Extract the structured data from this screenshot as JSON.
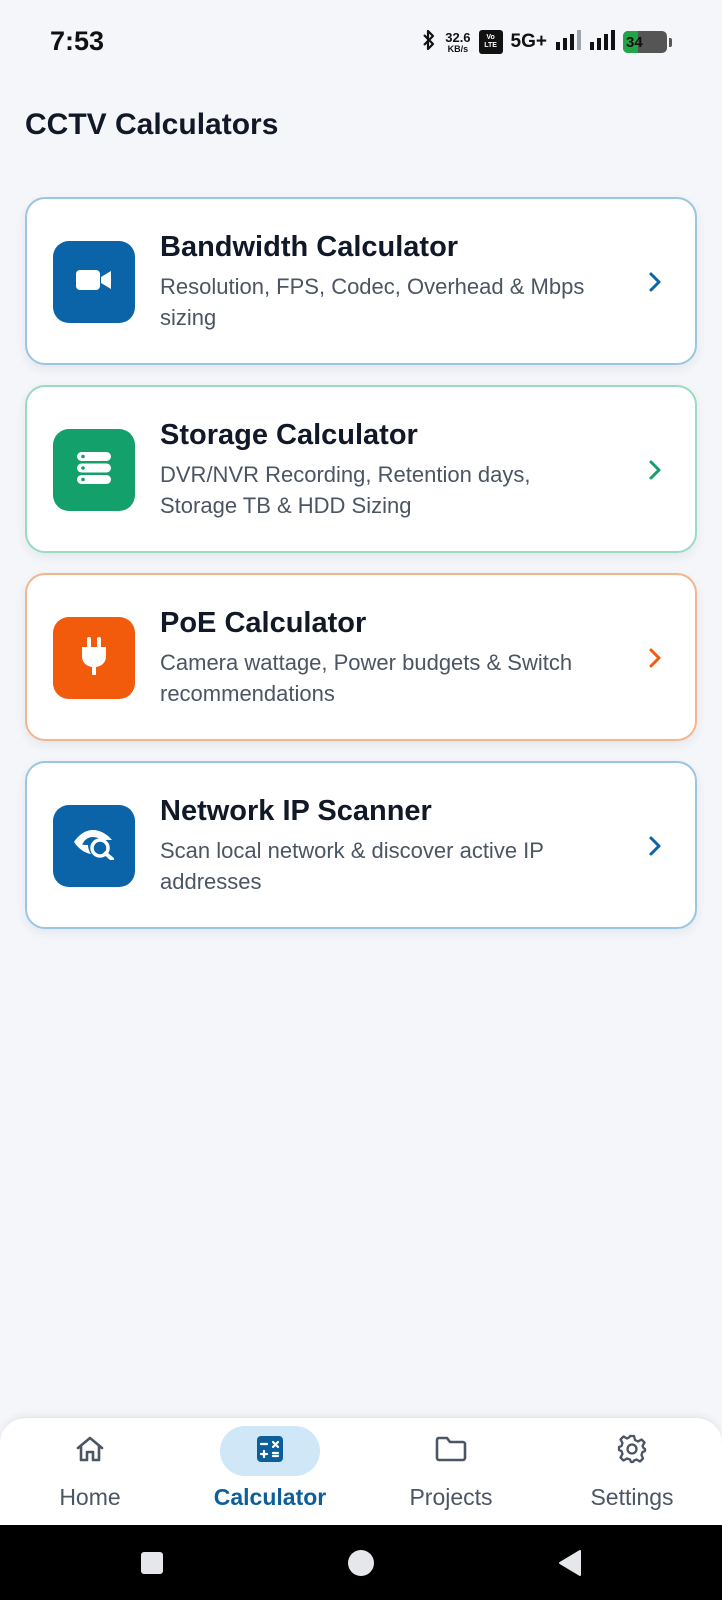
{
  "status_bar": {
    "time": "7:53",
    "speed_value": "32.6",
    "speed_unit": "KB/s",
    "volte_top": "Vo",
    "volte_bottom": "LTE",
    "network": "5G+",
    "battery_level": "34",
    "battery_fill_percent": 34,
    "icons": [
      "bluetooth-icon",
      "signal-icon",
      "signal-icon",
      "battery-charging-icon"
    ]
  },
  "page": {
    "title": "CCTV Calculators"
  },
  "cards": [
    {
      "title": "Bandwidth Calculator",
      "description": "Resolution, FPS, Codec, Overhead & Mbps sizing",
      "icon": "video-camera-icon",
      "color": "#0b63a8",
      "border": "#9bc6e3"
    },
    {
      "title": "Storage Calculator",
      "description": "DVR/NVR Recording, Retention days, Storage TB & HDD Sizing",
      "icon": "storage-server-icon",
      "color": "#14a06b",
      "border": "#9adbc2"
    },
    {
      "title": "PoE Calculator",
      "description": "Camera wattage, Power budgets & Switch recommendations",
      "icon": "power-plug-icon",
      "color": "#f25a0c",
      "border": "#f5b58c"
    },
    {
      "title": "Network IP Scanner",
      "description": "Scan local network & discover active IP addresses",
      "icon": "eye-search-icon",
      "color": "#0b63a8",
      "border": "#9bc6e3"
    }
  ],
  "bottom_nav": {
    "items": [
      {
        "label": "Home",
        "icon": "home-icon",
        "active": false
      },
      {
        "label": "Calculator",
        "icon": "calculator-icon",
        "active": true
      },
      {
        "label": "Projects",
        "icon": "folder-icon",
        "active": false
      },
      {
        "label": "Settings",
        "icon": "gear-icon",
        "active": false
      }
    ]
  },
  "system_nav": {
    "icons": [
      "recents-icon",
      "home-circle-icon",
      "back-icon"
    ]
  }
}
